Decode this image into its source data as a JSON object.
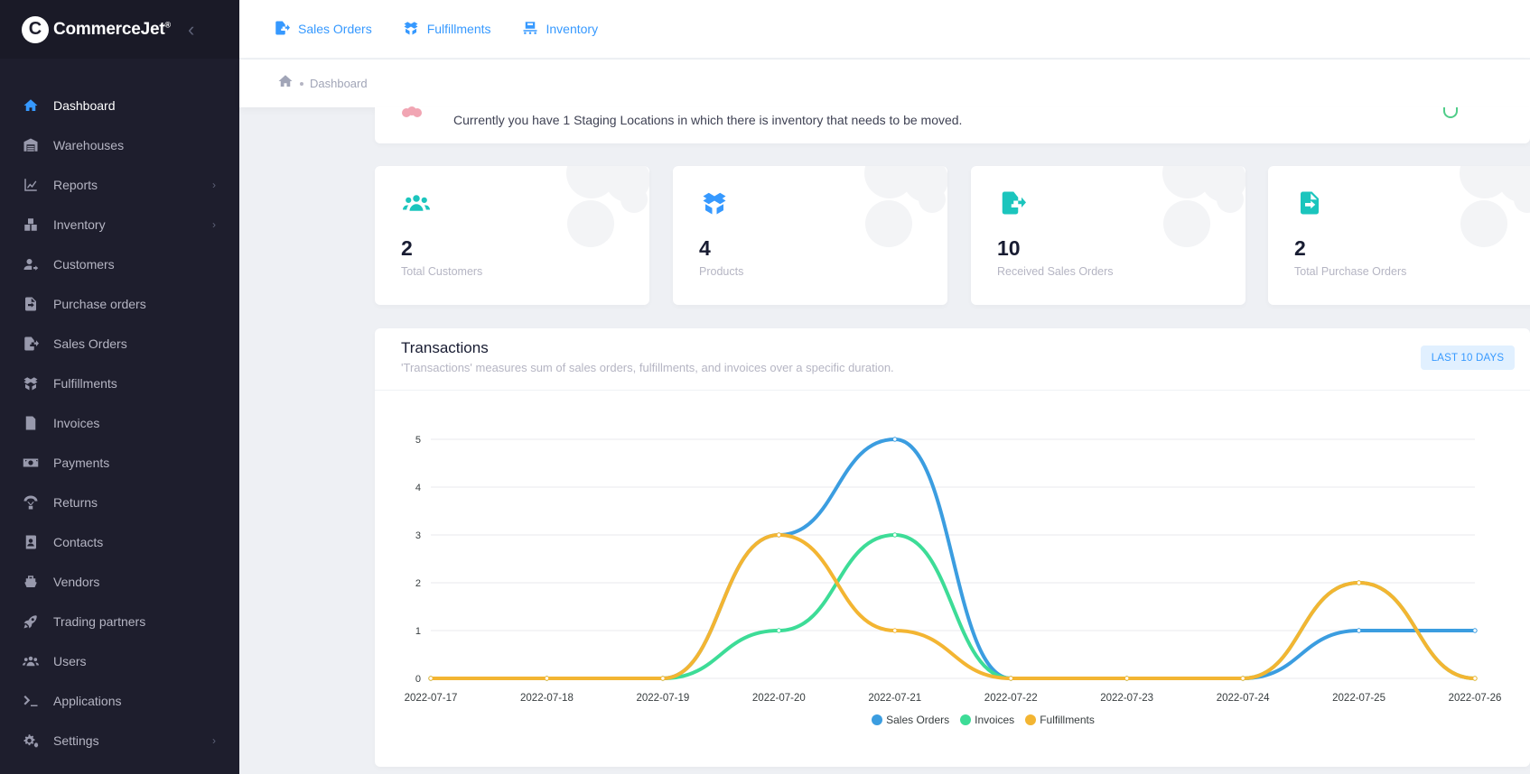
{
  "brand": {
    "logo_letter": "C",
    "name": "CommerceJet",
    "mark": "®"
  },
  "sidebar": {
    "items": [
      {
        "label": "Dashboard",
        "icon": "home-icon"
      },
      {
        "label": "Warehouses",
        "icon": "warehouse-icon"
      },
      {
        "label": "Reports",
        "icon": "chart-line-icon",
        "has_arrow": true
      },
      {
        "label": "Inventory",
        "icon": "boxes-icon",
        "has_arrow": true
      },
      {
        "label": "Customers",
        "icon": "user-arrow-icon"
      },
      {
        "label": "Purchase orders",
        "icon": "file-import-icon"
      },
      {
        "label": "Sales Orders",
        "icon": "file-export-icon"
      },
      {
        "label": "Fulfillments",
        "icon": "box-open-icon"
      },
      {
        "label": "Invoices",
        "icon": "invoice-icon"
      },
      {
        "label": "Payments",
        "icon": "money-bill-icon"
      },
      {
        "label": "Returns",
        "icon": "parachute-box-icon"
      },
      {
        "label": "Contacts",
        "icon": "address-book-icon"
      },
      {
        "label": "Vendors",
        "icon": "ship-icon"
      },
      {
        "label": "Trading partners",
        "icon": "rocket-icon"
      },
      {
        "label": "Users",
        "icon": "users-icon"
      },
      {
        "label": "Applications",
        "icon": "terminal-icon"
      },
      {
        "label": "Settings",
        "icon": "cogs-icon",
        "has_arrow": true
      }
    ],
    "active": "Dashboard"
  },
  "topnav": {
    "links": [
      {
        "label": "Sales Orders",
        "icon": "file-export-icon"
      },
      {
        "label": "Fulfillments",
        "icon": "box-open-icon"
      },
      {
        "label": "Inventory",
        "icon": "pallet-icon"
      }
    ]
  },
  "breadcrumb": {
    "current": "Dashboard"
  },
  "alert": {
    "text": "Currently you have 1 Staging Locations in which there is inventory that needs to be moved."
  },
  "stats": [
    {
      "value": "2",
      "label": "Total Customers",
      "icon": "users-icon",
      "color": "#1bc5bd"
    },
    {
      "value": "4",
      "label": "Products",
      "icon": "box-open-icon",
      "color": "#3699ff"
    },
    {
      "value": "10",
      "label": "Received Sales Orders",
      "icon": "file-export-icon",
      "color": "#1bc5bd"
    },
    {
      "value": "2",
      "label": "Total Purchase Orders",
      "icon": "file-import-icon",
      "color": "#1bc5bd"
    }
  ],
  "transactions": {
    "title": "Transactions",
    "subtitle": "'Transactions' measures sum of sales orders, fulfillments, and invoices over a specific duration.",
    "range_button": "LAST 10 DAYS"
  },
  "chart_data": {
    "type": "line",
    "x": [
      "2022-07-17",
      "2022-07-18",
      "2022-07-19",
      "2022-07-20",
      "2022-07-21",
      "2022-07-22",
      "2022-07-23",
      "2022-07-24",
      "2022-07-25",
      "2022-07-26"
    ],
    "series": [
      {
        "name": "Sales Orders",
        "color": "#3b9de0",
        "values": [
          0,
          0,
          0,
          3,
          5,
          0,
          0,
          0,
          1,
          1
        ]
      },
      {
        "name": "Invoices",
        "color": "#3ddc97",
        "values": [
          0,
          0,
          0,
          1,
          3,
          0,
          0,
          0,
          2,
          0
        ]
      },
      {
        "name": "Fulfillments",
        "color": "#f3b532",
        "values": [
          0,
          0,
          0,
          3,
          1,
          0,
          0,
          0,
          2,
          0
        ]
      }
    ],
    "ylim": [
      0,
      5
    ],
    "yticks": [
      0,
      1,
      2,
      3,
      4,
      5
    ],
    "grid": true,
    "smooth": true,
    "legend": "bottom-center"
  }
}
